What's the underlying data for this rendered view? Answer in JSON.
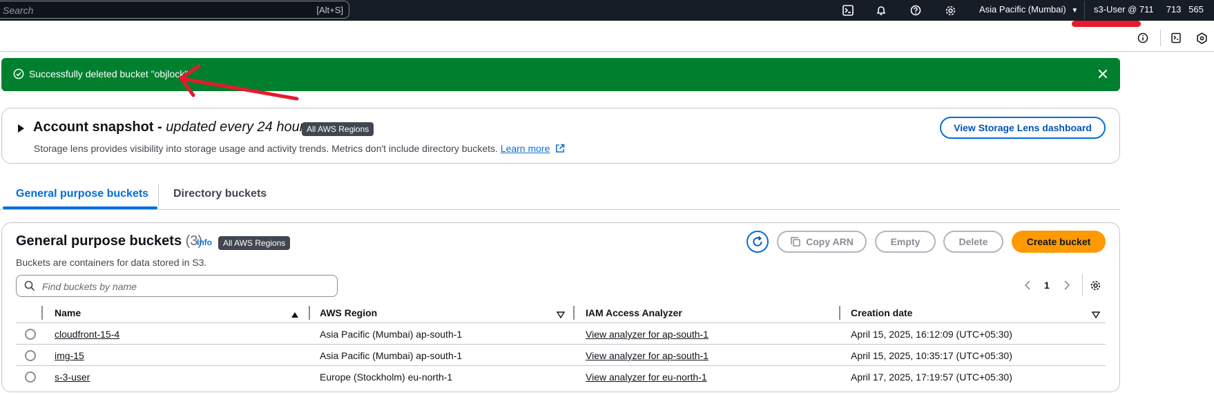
{
  "topbar": {
    "search_placeholder": "Search",
    "search_shortcut": "[Alt+S]",
    "region": "Asia Pacific (Mumbai)",
    "user": "s3-User @ 711     713   565"
  },
  "flash": {
    "message": "Successfully deleted bucket \"objlock\""
  },
  "snapshot": {
    "title": "Account snapshot - ",
    "title_italic": "updated every 24 hours",
    "badge": "All AWS Regions",
    "description": "Storage lens provides visibility into storage usage and activity trends. Metrics don't include directory buckets. ",
    "learn_more": "Learn more",
    "dashboard_button": "View Storage Lens dashboard"
  },
  "tabs": [
    {
      "label": "General purpose buckets"
    },
    {
      "label": "Directory buckets"
    }
  ],
  "buckets_panel": {
    "title": "General purpose buckets",
    "count": "(3)",
    "info": "Info",
    "badge": "All AWS Regions",
    "description": "Buckets are containers for data stored in S3.",
    "copy_arn": "Copy ARN",
    "empty": "Empty",
    "delete": "Delete",
    "create": "Create bucket",
    "search_placeholder": "Find buckets by name",
    "page": "1"
  },
  "table": {
    "columns": [
      "Name",
      "AWS Region",
      "IAM Access Analyzer",
      "Creation date"
    ],
    "rows": [
      {
        "name": "cloudfront-15-4",
        "region": "Asia Pacific (Mumbai) ap-south-1",
        "analyzer": "View analyzer for ap-south-1",
        "date": "April 15, 2025, 16:12:09 (UTC+05:30)"
      },
      {
        "name": "img-15",
        "region": "Asia Pacific (Mumbai) ap-south-1",
        "analyzer": "View analyzer for ap-south-1",
        "date": "April 15, 2025, 10:35:17 (UTC+05:30)"
      },
      {
        "name": "s-3-user",
        "region": "Europe (Stockholm) eu-north-1",
        "analyzer": "View analyzer for eu-north-1",
        "date": "April 17, 2025, 17:19:57 (UTC+05:30)"
      }
    ]
  },
  "colors": {
    "flash_bg": "#00802f",
    "accent": "#006ce0",
    "primary_button": "#ff9900",
    "topbar_bg": "#161d26"
  }
}
